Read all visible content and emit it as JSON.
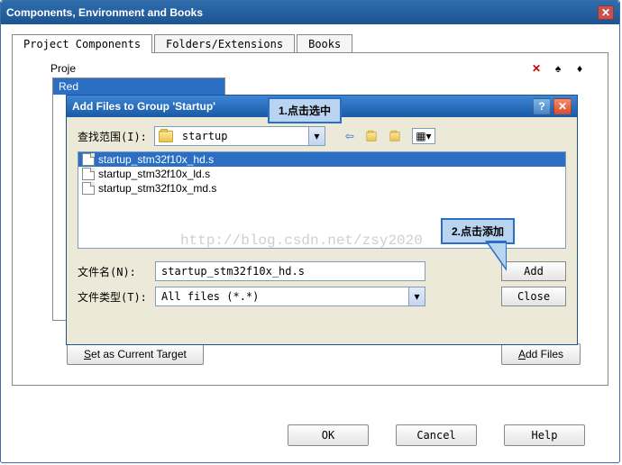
{
  "outer": {
    "title": "Components, Environment and Books",
    "tabs": [
      "Project Components",
      "Folders/Extensions",
      "Books"
    ],
    "active_tab": 0,
    "left_header": "Proje",
    "group_items": [
      "Red"
    ],
    "set_target_btn": "Set as Current Target",
    "add_files_btn": "Add Files",
    "ok": "OK",
    "cancel": "Cancel",
    "help": "Help"
  },
  "inner": {
    "title": "Add Files to Group 'Startup'",
    "lookin_label": "查找范围(I):",
    "lookin_value": "startup",
    "files": [
      {
        "name": "startup_stm32f10x_hd.s",
        "selected": true
      },
      {
        "name": "startup_stm32f10x_ld.s",
        "selected": false
      },
      {
        "name": "startup_stm32f10x_md.s",
        "selected": false
      }
    ],
    "filename_label": "文件名(N):",
    "filename_value": "startup_stm32f10x_hd.s",
    "filetype_label": "文件类型(T):",
    "filetype_value": "All files (*.*)",
    "add_btn": "Add",
    "close_btn": "Close"
  },
  "annotations": {
    "callout1": "1.点击选中",
    "callout2": "2.点击添加"
  },
  "watermark": "http://blog.csdn.net/zsy2020",
  "icons": {
    "delete": "✕",
    "up": "↑",
    "down": "↓",
    "back": "←",
    "parent": "folder-up",
    "newfolder": "folder-new",
    "view": "view-menu",
    "help": "?",
    "close": "✕"
  }
}
